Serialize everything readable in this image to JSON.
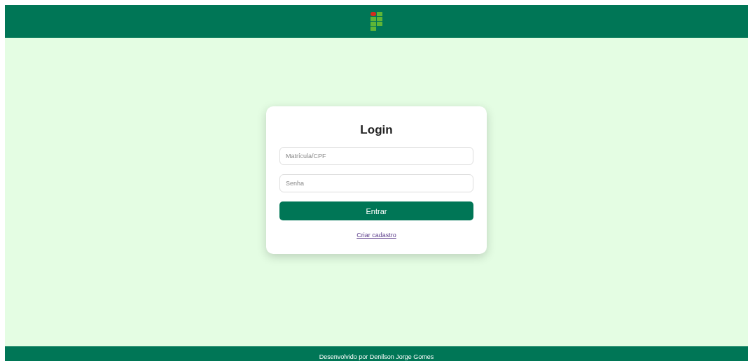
{
  "login": {
    "title": "Login",
    "fields": [
      {
        "placeholder": "Matrícula/CPF"
      },
      {
        "placeholder": "Senha"
      }
    ],
    "submit": "Entrar",
    "link": "Criar cadastro"
  },
  "footer": {
    "text": "Desenvolvido por Denilson Jorge Gomes"
  }
}
